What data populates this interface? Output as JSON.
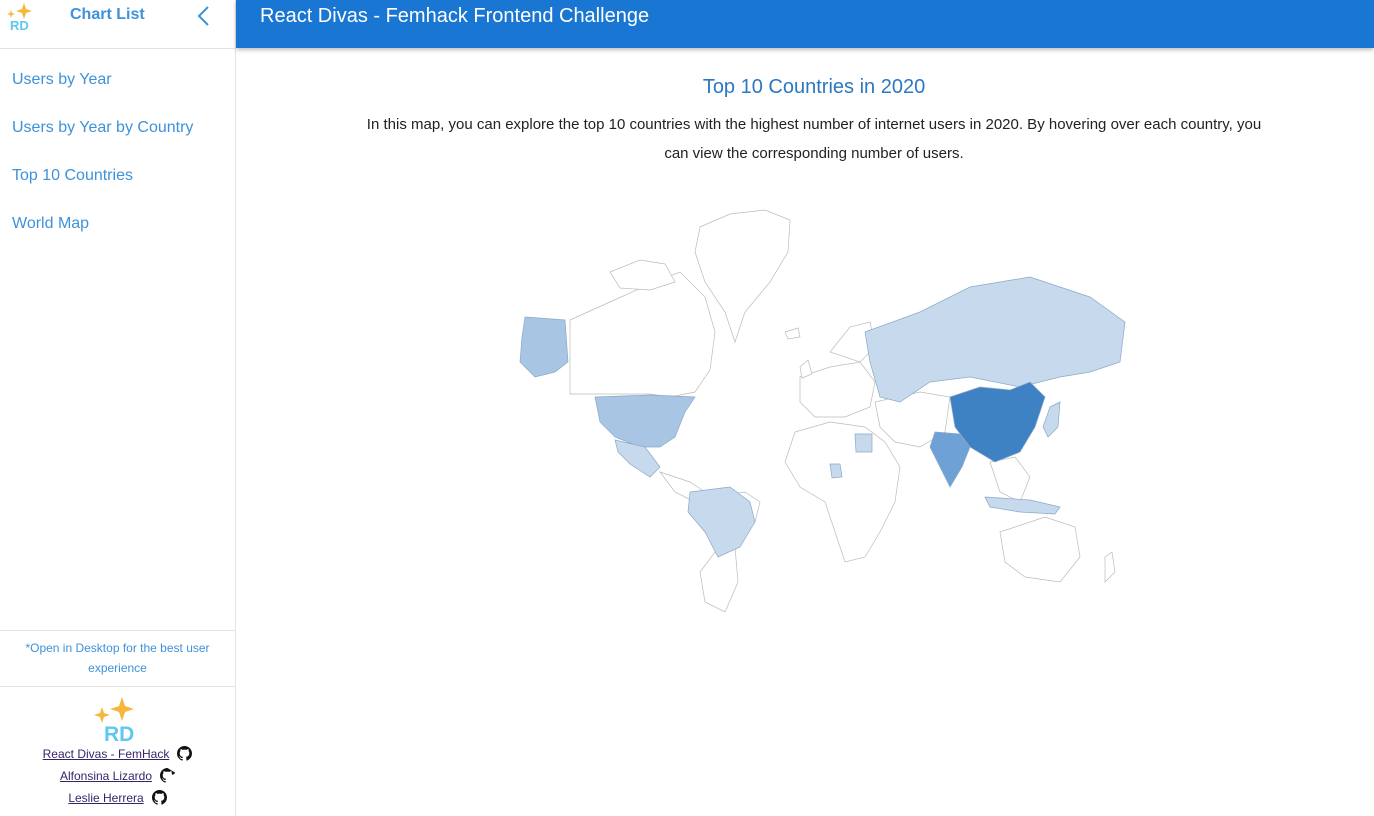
{
  "sidebar": {
    "logo_text": "RD",
    "title": "Chart List",
    "collapse_icon": "chevron-left-icon",
    "items": [
      {
        "label": "Users by Year"
      },
      {
        "label": "Users by Year by Country"
      },
      {
        "label": "Top 10 Countries"
      },
      {
        "label": "World Map"
      }
    ],
    "note": "*Open in Desktop for the best user experience",
    "footer": {
      "logo_text": "RD",
      "credits": [
        {
          "label": "React Divas - FemHack",
          "icon": "github-icon"
        },
        {
          "label": "Alfonsina Lizardo",
          "icon": "github-icon"
        },
        {
          "label": "Leslie Herrera",
          "icon": "github-icon"
        }
      ]
    }
  },
  "header": {
    "title": "React Divas - Femhack Frontend Challenge"
  },
  "main": {
    "heading": "Top 10 Countries in 2020",
    "description": "In this map, you can explore the top 10 countries with the highest number of internet users in 2020. By hovering over each country, you can view the corresponding number of users."
  },
  "colors": {
    "accent": "#3e92d9",
    "header_bg": "#1976d2",
    "heading": "#2b78c2",
    "logo_star": "#f6b73c",
    "logo_text": "#5ec8f0",
    "map_dark": "#3f82c4",
    "map_mid": "#6ea2d6",
    "map_light": "#a9c5e4",
    "map_pale": "#c7d9ec"
  }
}
